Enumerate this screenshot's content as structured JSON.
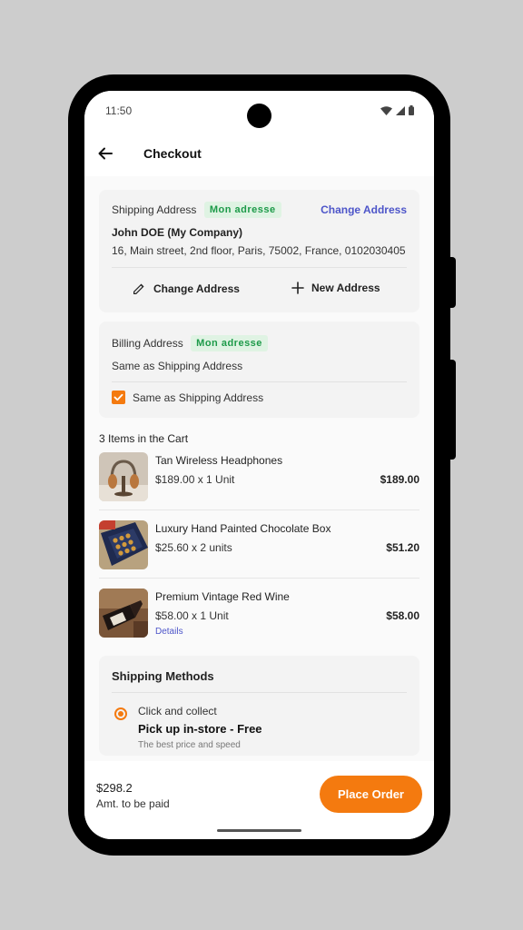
{
  "status": {
    "time": "11:50"
  },
  "appbar": {
    "title": "Checkout"
  },
  "shipping_address": {
    "label": "Shipping Address",
    "tag": "Mon adresse",
    "change_link": "Change Address",
    "name": "John DOE (My Company)",
    "address": "16, Main street, 2nd floor, Paris, 75002, France, 0102030405",
    "change_button": "Change Address",
    "new_button": "New Address"
  },
  "billing_address": {
    "label": "Billing Address",
    "tag": "Mon adresse",
    "value": "Same as Shipping Address",
    "checkbox_label": "Same as Shipping Address",
    "checked": true
  },
  "cart": {
    "title": "3 Items in the Cart",
    "items": [
      {
        "name": "Tan Wireless Headphones",
        "qty": "$189.00 x 1 Unit",
        "price": "$189.00",
        "image": "headphones"
      },
      {
        "name": "Luxury Hand Painted Chocolate Box",
        "qty": "$25.60 x 2 units",
        "price": "$51.20",
        "image": "chocolate-box"
      },
      {
        "name": "Premium Vintage Red Wine",
        "qty": "$58.00 x 1 Unit",
        "price": "$58.00",
        "details": "Details",
        "image": "wine-bottle"
      }
    ]
  },
  "shipping_methods": {
    "title": "Shipping Methods",
    "options": [
      {
        "label": "Click and collect",
        "title": "Pick up in-store - Free",
        "desc": "The best price and speed",
        "selected": true
      }
    ]
  },
  "footer": {
    "total": "$298.2",
    "total_label": "Amt. to be paid",
    "place_order": "Place Order"
  },
  "colors": {
    "accent": "#f47a0f",
    "link": "#4d55c9",
    "tag_bg": "#dff3e3",
    "tag_text": "#1d9a49"
  }
}
